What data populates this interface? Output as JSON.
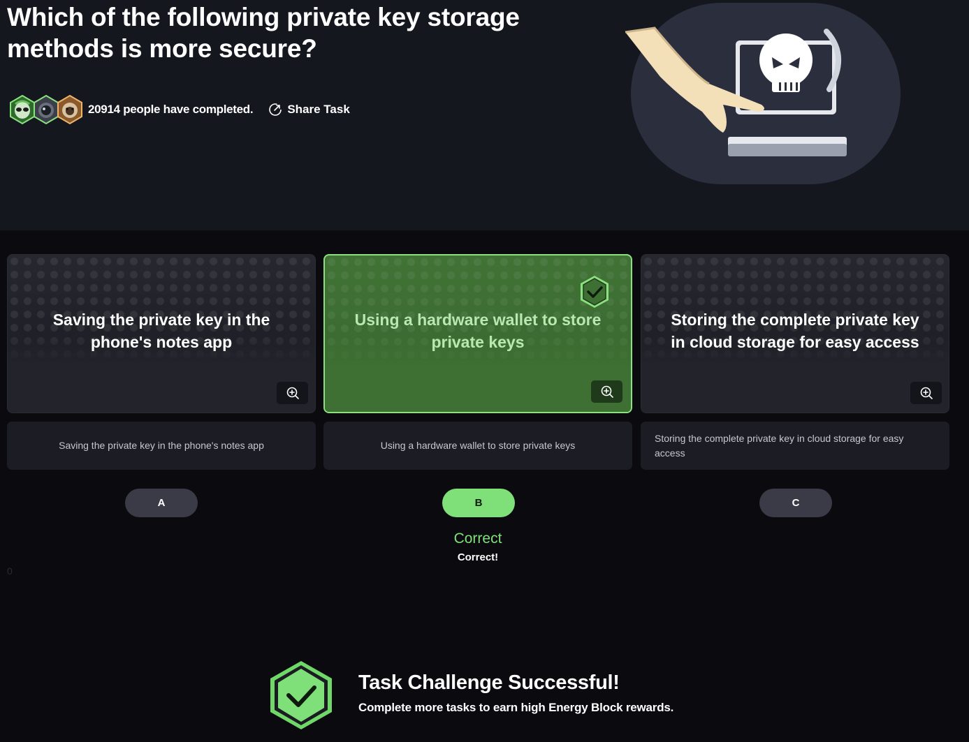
{
  "question": {
    "title": "Which of the following private key storage methods is more secure?"
  },
  "stats": {
    "completed_text": "20914 people have completed.",
    "share_label": "Share Task",
    "avatar_icons": [
      "alien-avatar-icon",
      "astronaut-avatar-icon",
      "monkey-avatar-icon"
    ]
  },
  "options": [
    {
      "key": "A",
      "card_text": "Saving the private key in the phone's notes app",
      "description": "Saving the private key in the phone's notes app",
      "selected": false
    },
    {
      "key": "B",
      "card_text": "Using a hardware wallet to store private keys",
      "description": "Using a hardware wallet to store private keys",
      "selected": true
    },
    {
      "key": "C",
      "card_text": "Storing the complete private key in cloud storage for easy access",
      "description": "Storing the complete private key in cloud storage for easy access",
      "selected": false
    }
  ],
  "result": {
    "title": "Correct",
    "subtitle": "Correct!",
    "stray_char": "0"
  },
  "success": {
    "title": "Task Challenge Successful!",
    "subtitle": "Complete more tasks to earn high Energy Block rewards."
  },
  "colors": {
    "background": "#0b0b0f",
    "header": "#15171f",
    "accent_green": "#7fe07a",
    "card_selected": "#3d7032",
    "card_default": "#22232b"
  }
}
